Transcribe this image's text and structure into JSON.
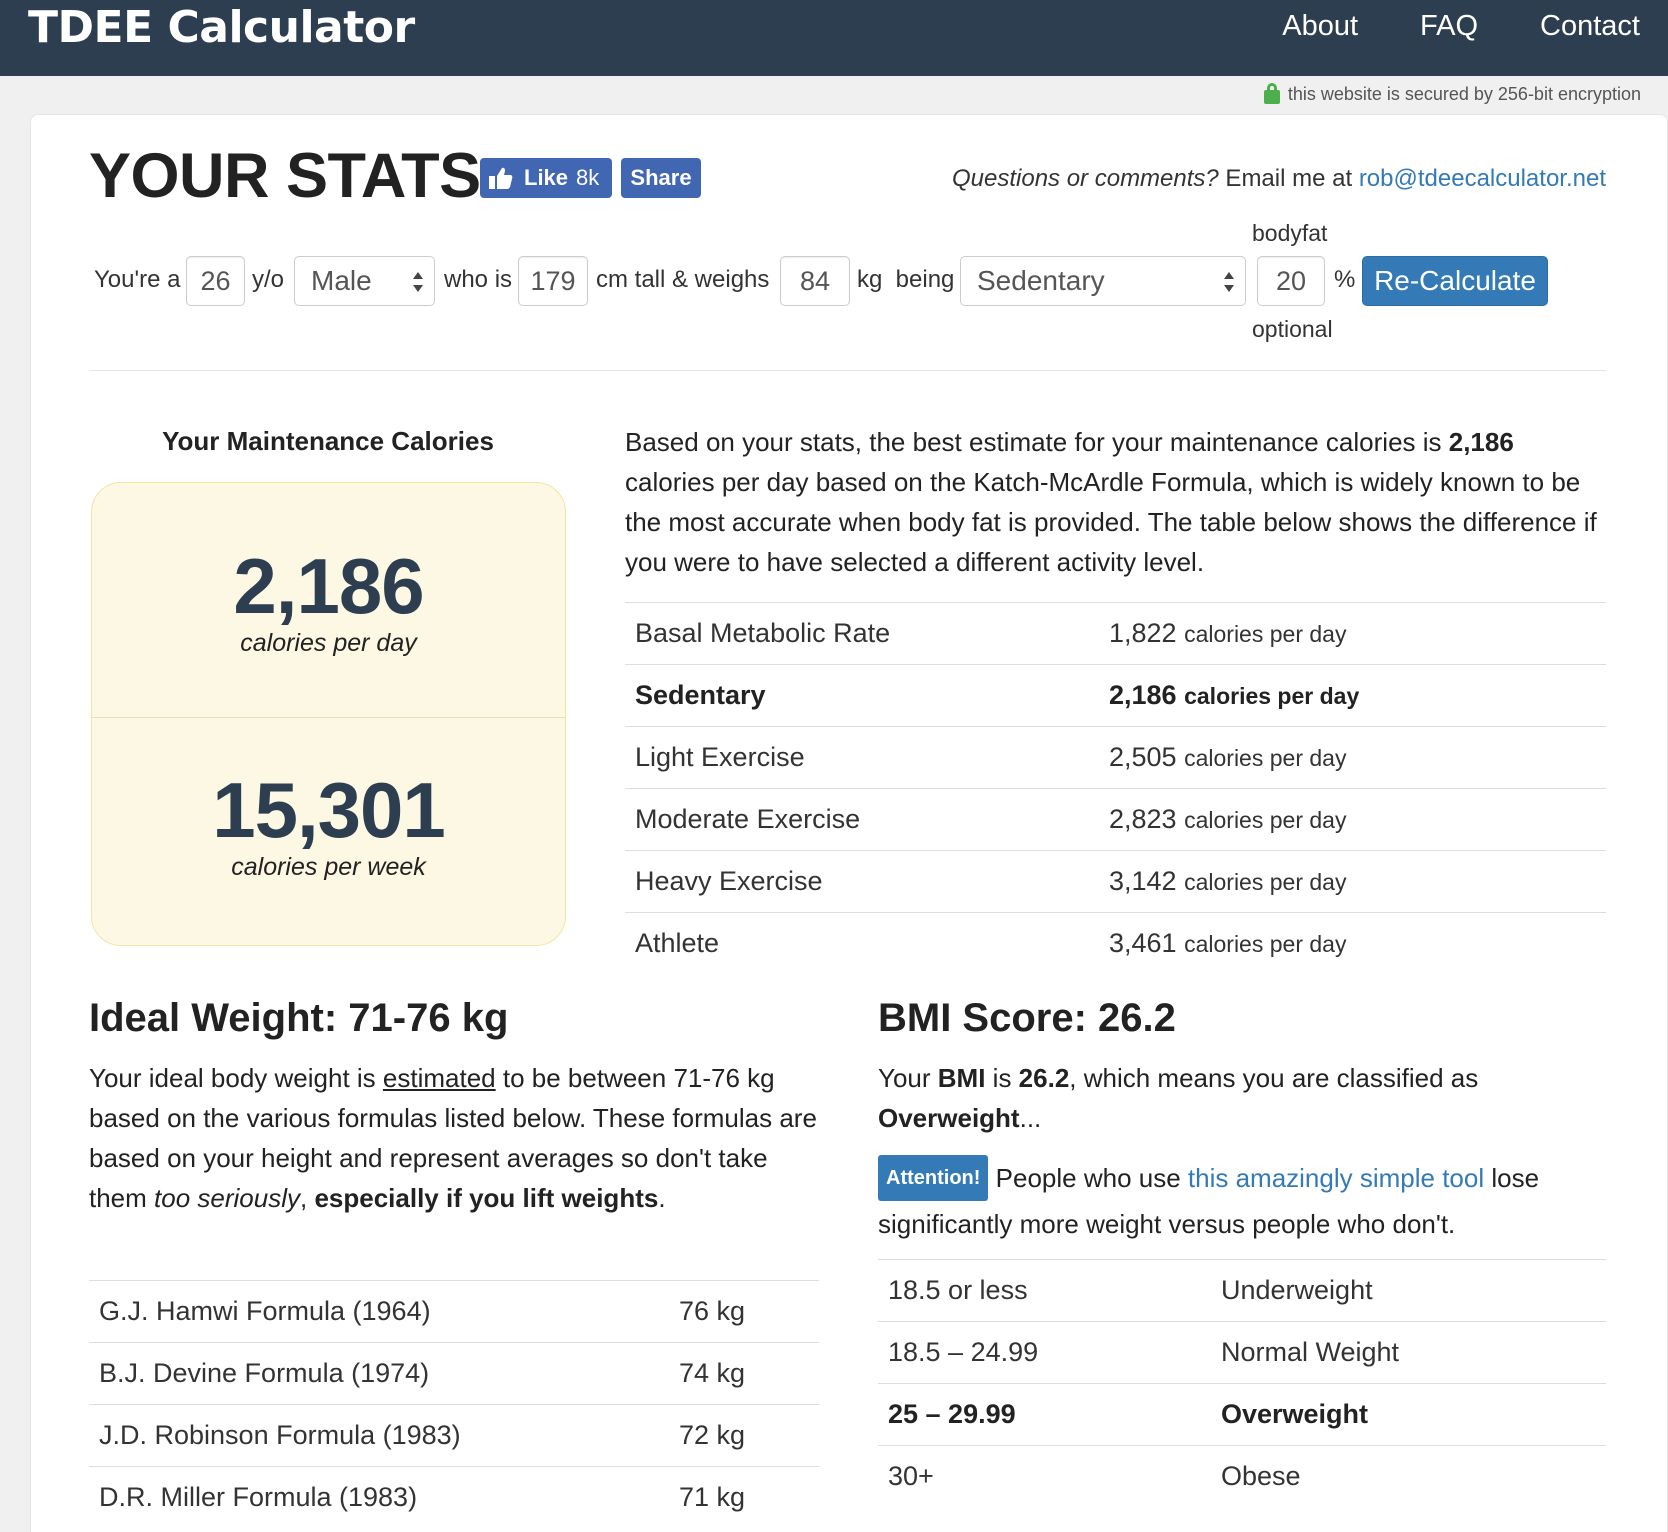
{
  "nav": {
    "brand": "TDEE Calculator",
    "links": [
      "About",
      "FAQ",
      "Contact"
    ]
  },
  "security_note": "this website is secured by 256-bit encryption",
  "header": {
    "title": "YOUR STATS",
    "fb_like_label": "Like",
    "fb_like_count": "8k",
    "fb_share_label": "Share",
    "contact_prefix": "Questions or comments?",
    "contact_mid": " Email me at ",
    "contact_email": "rob@tdeecalculator.net"
  },
  "form": {
    "youre_a": "You're a",
    "age": "26",
    "yo": "y/o",
    "gender": "Male",
    "who_is": "who is",
    "height": "179",
    "cm_tall": "cm tall & weighs",
    "weight": "84",
    "kg_being": "kg  being",
    "activity": "Sedentary",
    "bodyfat_label": "bodyfat",
    "bodyfat": "20",
    "percent": "%",
    "optional": "optional",
    "recalc_label": "Re-Calculate"
  },
  "maintenance": {
    "title": "Your Maintenance Calories",
    "per_day_value": "2,186",
    "per_day_label": "calories per day",
    "per_week_value": "15,301",
    "per_week_label": "calories per week"
  },
  "summary": {
    "line_a": "Based on your stats, the best estimate for your maintenance calories is ",
    "value": "2,186",
    "line_b": " calories per day based on the Katch-McArdle Formula, which is widely known to be the most accurate when body fat is provided. The table below shows the difference if you were to have selected a different activity level."
  },
  "activity_table": {
    "unit": "calories per day",
    "rows": [
      {
        "label": "Basal Metabolic Rate",
        "value": "1,822"
      },
      {
        "label": "Sedentary",
        "value": "2,186"
      },
      {
        "label": "Light Exercise",
        "value": "2,505"
      },
      {
        "label": "Moderate Exercise",
        "value": "2,823"
      },
      {
        "label": "Heavy Exercise",
        "value": "3,142"
      },
      {
        "label": "Athlete",
        "value": "3,461"
      }
    ]
  },
  "ideal_weight": {
    "title": "Ideal Weight: 71-76 kg",
    "p_a": "Your ideal body weight is ",
    "p_link": "estimated",
    "p_b": " to be between 71-76 kg based on the various formulas listed below. These formulas are based on your height and represent averages so don't take them ",
    "p_italic": "too seriously",
    "p_c": ", ",
    "p_bold": "especially if you lift weights",
    "p_end": ".",
    "rows": [
      {
        "label": "G.J. Hamwi Formula (1964)",
        "value": "76 kg"
      },
      {
        "label": "B.J. Devine Formula (1974)",
        "value": "74 kg"
      },
      {
        "label": "J.D. Robinson Formula (1983)",
        "value": "72 kg"
      },
      {
        "label": "D.R. Miller Formula (1983)",
        "value": "71 kg"
      }
    ]
  },
  "bmi": {
    "title": "BMI Score: 26.2",
    "p_a": "Your ",
    "p_bmi": "BMI",
    "p_is": " is ",
    "p_val": "26.2",
    "p_b": ", which means you are classified as ",
    "p_class": "Overweight",
    "p_ellipsis": "...",
    "badge": "Attention!",
    "att_a": " People who use ",
    "att_link": "this amazingly simple tool",
    "att_b": " lose significantly more weight versus people who don't.",
    "rows": [
      {
        "range": "18.5 or less",
        "class": "Underweight"
      },
      {
        "range": "18.5 – 24.99",
        "class": "Normal Weight"
      },
      {
        "range": "25 – 29.99",
        "class": "Overweight"
      },
      {
        "range": "30+",
        "class": "Obese"
      }
    ]
  },
  "colors": {
    "navbar": "#2c3e50",
    "primary": "#337ab7",
    "facebook": "#4267b2",
    "highlight_box": "#fcf8e3",
    "lock": "#4cae4c"
  }
}
